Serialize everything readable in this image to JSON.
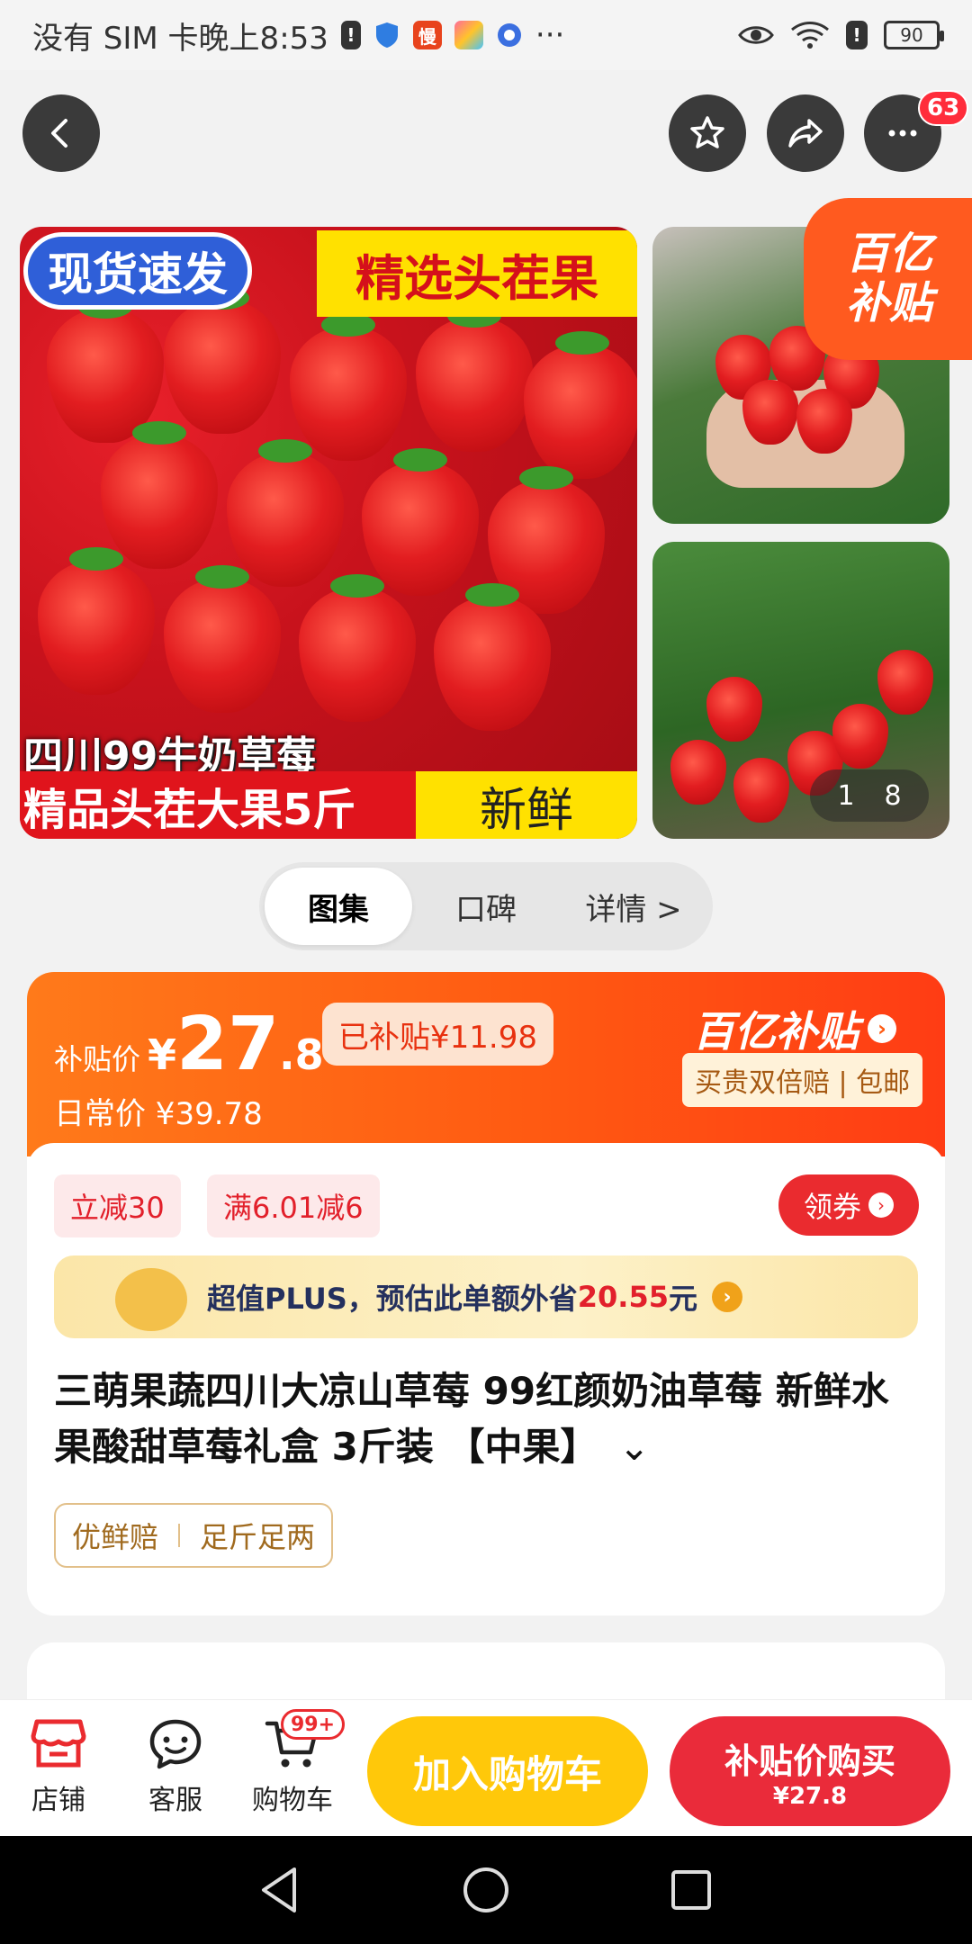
{
  "status_bar": {
    "carrier_time": "没有 SIM 卡晚上8:53",
    "dots": "···",
    "battery": "90",
    "app_badges": [
      "!",
      "慢"
    ]
  },
  "top_bar": {
    "message_count": "63"
  },
  "gallery": {
    "badge_blue": "现货速发",
    "badge_yellow": "精选头茬果",
    "caption_line1": "四川99牛奶草莓",
    "caption_red": "精品头茬大果5斤",
    "caption_yellow": "新鲜",
    "subsidy_badge_line1": "百亿",
    "subsidy_badge_line2": "补贴",
    "page_current": "1",
    "page_total": "8"
  },
  "view_tabs": [
    {
      "label": "图集",
      "active": true
    },
    {
      "label": "口碑",
      "active": false
    },
    {
      "label": "详情 >",
      "active": false
    }
  ],
  "price": {
    "label": "补贴价",
    "yen": "¥",
    "integer": "27",
    "decimal": ".8",
    "subsidy_chip": "已补贴¥11.98",
    "regular_label": "日常价 ¥39.78",
    "program_name": "百亿补贴",
    "guarantee": "买贵双倍赔 | 包邮"
  },
  "coupons": {
    "items": [
      "立减30",
      "满6.01减6"
    ],
    "claim_label": "领券"
  },
  "plus_banner": {
    "text_prefix": "超值PLUS，预估此单额外省",
    "amount": "20.55",
    "suffix": "元"
  },
  "product": {
    "title": "三萌果蔬四川大凉山草莓 99红颜奶油草莓 新鲜水果酸甜草莓礼盒 3斤装 【中果】",
    "expand_icon": "chevron-down-icon",
    "tags": [
      "优鲜赔",
      "足斤足两"
    ]
  },
  "bottom_bar": {
    "shop": "店铺",
    "service": "客服",
    "cart": "购物车",
    "cart_badge": "99+",
    "add_to_cart": "加入购物车",
    "buy_line1": "补贴价购买",
    "buy_line2": "¥27.8"
  },
  "colors": {
    "accent_orange": "#ff5a12",
    "accent_red": "#ea2b3a",
    "add_cart_yellow": "#ffc80a"
  }
}
